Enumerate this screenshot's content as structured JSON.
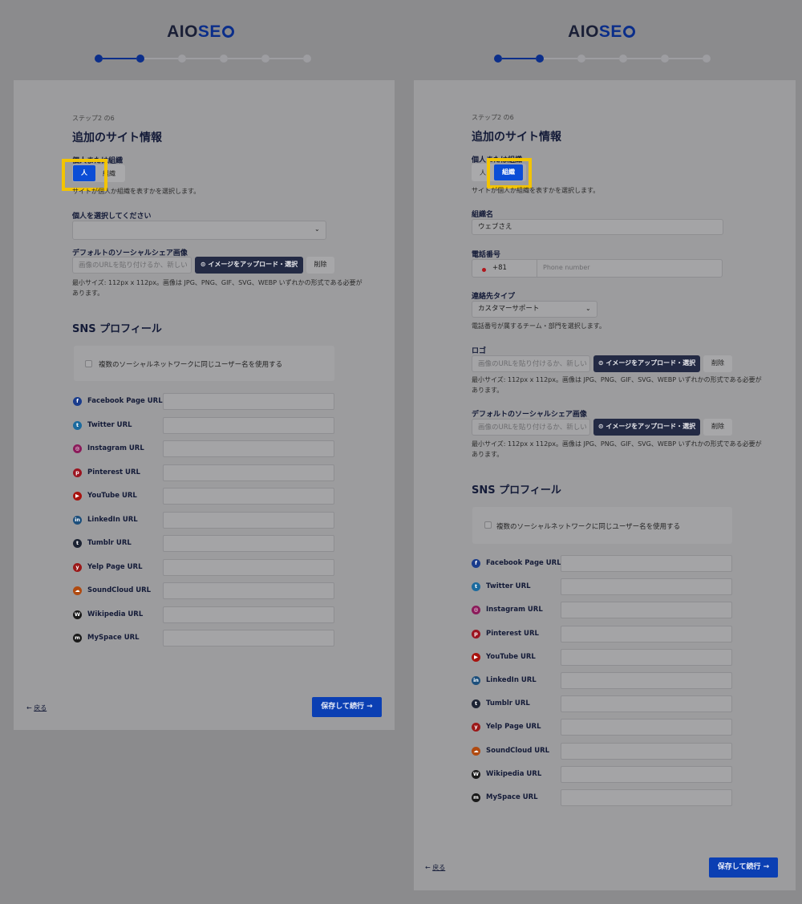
{
  "brand": {
    "logo_left": "AIO",
    "logo_right": "SE"
  },
  "colors": {
    "accent": "#0b2e8a",
    "selected": "#0b4dd6",
    "highlight": "#f3c400",
    "save": "#0b3fb3"
  },
  "step_label": "ステップ2 の6",
  "title": "追加のサイト情報",
  "person_or_org_label": "個人または組織",
  "person_option": "人",
  "org_option": "組織",
  "person_or_org_hint": "サイトが個人か組織を表すかを選択します。",
  "left": {
    "select_person_label": "個人を選択してください",
    "select_person_value": ""
  },
  "right": {
    "org_name_label": "組織名",
    "org_name_value": "ウェブさえ",
    "phone_label": "電話番号",
    "phone_code": "+81",
    "phone_placeholder": "Phone number",
    "contact_type_label": "連絡先タイプ",
    "contact_type_value": "カスタマーサポート",
    "contact_type_hint": "電話番号が属するチーム・部門を選択します。",
    "logo_label": "ロゴ"
  },
  "image_input_placeholder": "画像のURLを貼り付けるか、新しい",
  "upload_button": "イメージをアップロード・選択",
  "delete_button": "削除",
  "image_hint_line1": "最小サイズ: 112px x 112px。画像は JPG、PNG、GIF、SVG、WEBP いずれかの形式である必要が",
  "image_hint_line2": "あります。",
  "default_social_image_label": "デフォルトのソーシャルシェア画像",
  "sns_title": "SNS プロフィール",
  "same_username_label": "複数のソーシャルネットワークに同じユーザー名を使用する",
  "social": [
    {
      "label": "Facebook Page URL",
      "icon": "facebook-icon",
      "glyph": "f",
      "color": "#1a3c8c"
    },
    {
      "label": "Twitter URL",
      "icon": "twitter-icon",
      "glyph": "t",
      "color": "#1b6a9e"
    },
    {
      "label": "Instagram URL",
      "icon": "instagram-icon",
      "glyph": "◎",
      "color": "#8b1a5a"
    },
    {
      "label": "Pinterest URL",
      "icon": "pinterest-icon",
      "glyph": "p",
      "color": "#9b1420"
    },
    {
      "label": "YouTube URL",
      "icon": "youtube-icon",
      "glyph": "▶",
      "color": "#a8130f"
    },
    {
      "label": "LinkedIn URL",
      "icon": "linkedin-icon",
      "glyph": "in",
      "color": "#1c4f7c"
    },
    {
      "label": "Tumblr URL",
      "icon": "tumblr-icon",
      "glyph": "t",
      "color": "#1c2333"
    },
    {
      "label": "Yelp Page URL",
      "icon": "yelp-icon",
      "glyph": "y",
      "color": "#9b1818"
    },
    {
      "label": "SoundCloud URL",
      "icon": "soundcloud-icon",
      "glyph": "☁",
      "color": "#b04a10"
    },
    {
      "label": "Wikipedia URL",
      "icon": "wikipedia-icon",
      "glyph": "W",
      "color": "#1a1a1a"
    },
    {
      "label": "MySpace URL",
      "icon": "myspace-icon",
      "glyph": "m",
      "color": "#1a1a1a"
    }
  ],
  "back_label": "戻る",
  "save_label": "保存して続行 →"
}
